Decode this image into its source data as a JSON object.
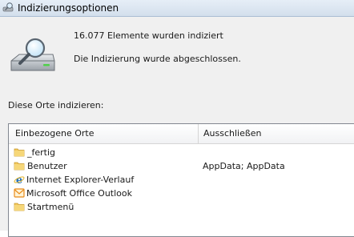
{
  "window": {
    "title": "Indizierungsoptionen",
    "icon": "indexing-options-icon"
  },
  "summary": {
    "count_text": "16.077 Elemente wurden indiziert",
    "status_text": "Die Indizierung wurde abgeschlossen."
  },
  "locations": {
    "label": "Diese Orte indizieren:",
    "columns": {
      "included": "Einbezogene Orte",
      "excluded": "Ausschließen"
    },
    "rows": [
      {
        "name": "_fertig",
        "excluded": "",
        "icon": "folder-icon"
      },
      {
        "name": "Benutzer",
        "excluded": "AppData; AppData",
        "icon": "folder-icon"
      },
      {
        "name": "Internet Explorer-Verlauf",
        "excluded": "",
        "icon": "internet-explorer-icon"
      },
      {
        "name": "Microsoft Office Outlook",
        "excluded": "",
        "icon": "outlook-icon"
      },
      {
        "name": "Startmenü",
        "excluded": "",
        "icon": "folder-icon"
      }
    ]
  },
  "colors": {
    "folder": "#f2c75c",
    "ie_blue": "#1f6fc1",
    "outlook_orange": "#e88b1a"
  }
}
